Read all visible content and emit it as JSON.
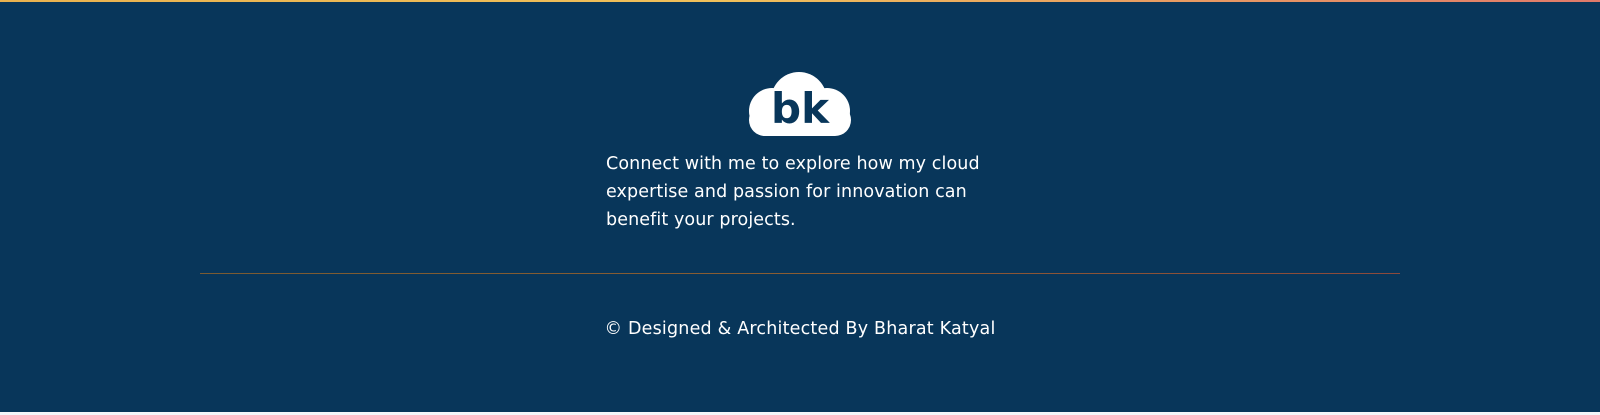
{
  "footer": {
    "logo": {
      "text": "bk",
      "icon": "cloud-logo-icon",
      "color": "#ffffff"
    },
    "tagline": "Connect with me to explore how my cloud expertise and passion for innovation can benefit your projects.",
    "copyright": "© Designed & Architected By Bharat Katyal"
  },
  "colors": {
    "background": "#08365a",
    "text": "#ffffff",
    "accent": "#f0c05a",
    "divider": "#8a5d33"
  }
}
